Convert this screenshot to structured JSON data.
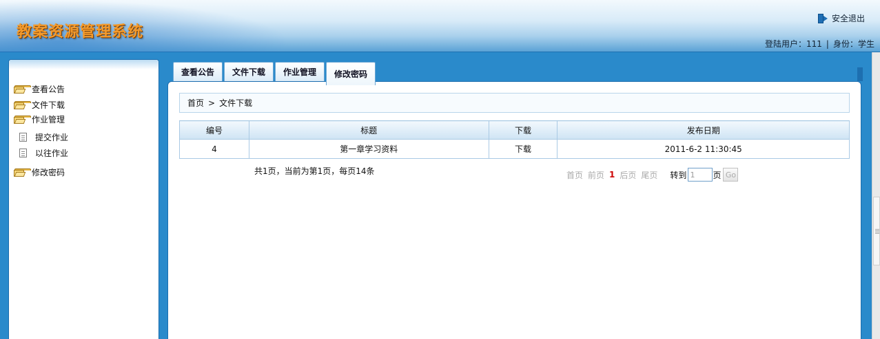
{
  "header": {
    "app_title": "教案资源管理系统",
    "logout_label": "安全退出",
    "user_label": "登陆用户：",
    "user_value": "111",
    "sep": "|",
    "role_label": "身份：",
    "role_value": "学生"
  },
  "sidebar": {
    "items": [
      {
        "label": "查看公告",
        "icon": "folder-icon"
      },
      {
        "label": "文件下载",
        "icon": "folder-icon"
      },
      {
        "label": "作业管理",
        "icon": "folder-icon"
      },
      {
        "label": "修改密码",
        "icon": "folder-icon"
      }
    ],
    "sub_items": [
      {
        "label": "提交作业",
        "icon": "document-icon"
      },
      {
        "label": "以往作业",
        "icon": "document-icon"
      }
    ]
  },
  "tabs": [
    {
      "label": "查看公告"
    },
    {
      "label": "文件下载"
    },
    {
      "label": "作业管理"
    },
    {
      "label": "修改密码"
    }
  ],
  "breadcrumb": {
    "home": "首页",
    "sep": ">",
    "current": "文件下载"
  },
  "table": {
    "columns": [
      "编号",
      "标题",
      "下载",
      "发布日期"
    ],
    "rows": [
      {
        "id": "4",
        "title": "第一章学习资料",
        "download": "下载",
        "date": "2011-6-2 11:30:45"
      }
    ]
  },
  "pager": {
    "summary": "共1页，当前为第1页，每页14条",
    "first": "首页",
    "prev": "前页",
    "current": "1",
    "next": "后页",
    "last": "尾页",
    "goto_label": "转到",
    "goto_value": "1",
    "page_unit": "页",
    "go_label": "Go"
  },
  "colors": {
    "accent": "#2a8acb",
    "title_orange": "#f39a2c",
    "current_page": "#cc0000"
  }
}
